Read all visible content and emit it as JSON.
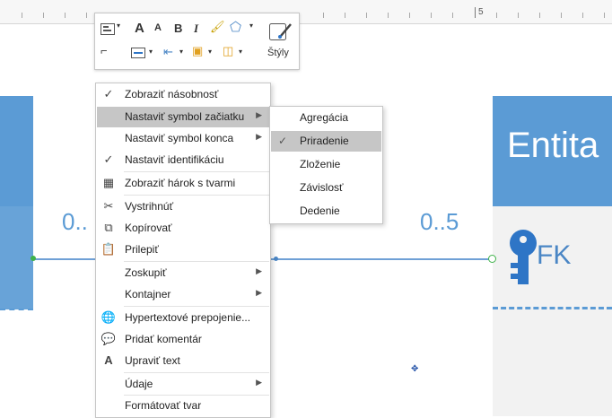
{
  "ruler": {
    "label": "5"
  },
  "diagram": {
    "right_entity_title": "Entita",
    "fk_label": "FK",
    "multiplicity_left": "0..",
    "multiplicity_right": "0..5",
    "accent_color": "#5b9bd5",
    "connector_endpoint_color": "#3fb24a"
  },
  "mini_toolbar": {
    "styles_label": "Štýly",
    "bold": "B",
    "italic": "I",
    "grow_font": "A",
    "shrink_font": "A"
  },
  "context_menu": {
    "items": [
      {
        "label": "Zobraziť násobnosť",
        "icon": "check-icon",
        "submenu": false,
        "checked": true
      },
      {
        "label": "Nastaviť symbol začiatku",
        "icon": "",
        "submenu": true,
        "highlighted": true
      },
      {
        "label": "Nastaviť symbol konca",
        "icon": "",
        "submenu": true
      },
      {
        "label": "Nastaviť identifikáciu",
        "icon": "check-icon",
        "submenu": false,
        "checked": true
      },
      {
        "label": "Zobraziť hárok s tvarmi",
        "icon": "shape-data-icon",
        "submenu": false
      },
      {
        "label": "Vystrihnúť",
        "icon": "cut-icon",
        "submenu": false
      },
      {
        "label": "Kopírovať",
        "icon": "copy-icon",
        "submenu": false
      },
      {
        "label": "Prilepiť",
        "icon": "paste-icon",
        "submenu": false
      },
      {
        "label": "Zoskupiť",
        "icon": "",
        "submenu": true
      },
      {
        "label": "Kontajner",
        "icon": "",
        "submenu": true
      },
      {
        "label": "Hypertextové prepojenie...",
        "icon": "hyperlink-icon",
        "submenu": false
      },
      {
        "label": "Pridať komentár",
        "icon": "comment-icon",
        "submenu": false
      },
      {
        "label": "Upraviť text",
        "icon": "edit-text-icon",
        "submenu": false
      },
      {
        "label": "Údaje",
        "icon": "",
        "submenu": true
      },
      {
        "label": "Formátovať tvar",
        "icon": "",
        "submenu": false
      }
    ]
  },
  "submenu": {
    "items": [
      {
        "label": "Agregácia",
        "checked": false
      },
      {
        "label": "Priradenie",
        "checked": true,
        "highlighted": true
      },
      {
        "label": "Zloženie",
        "checked": false
      },
      {
        "label": "Závislosť",
        "checked": false
      },
      {
        "label": "Dedenie",
        "checked": false
      }
    ]
  }
}
